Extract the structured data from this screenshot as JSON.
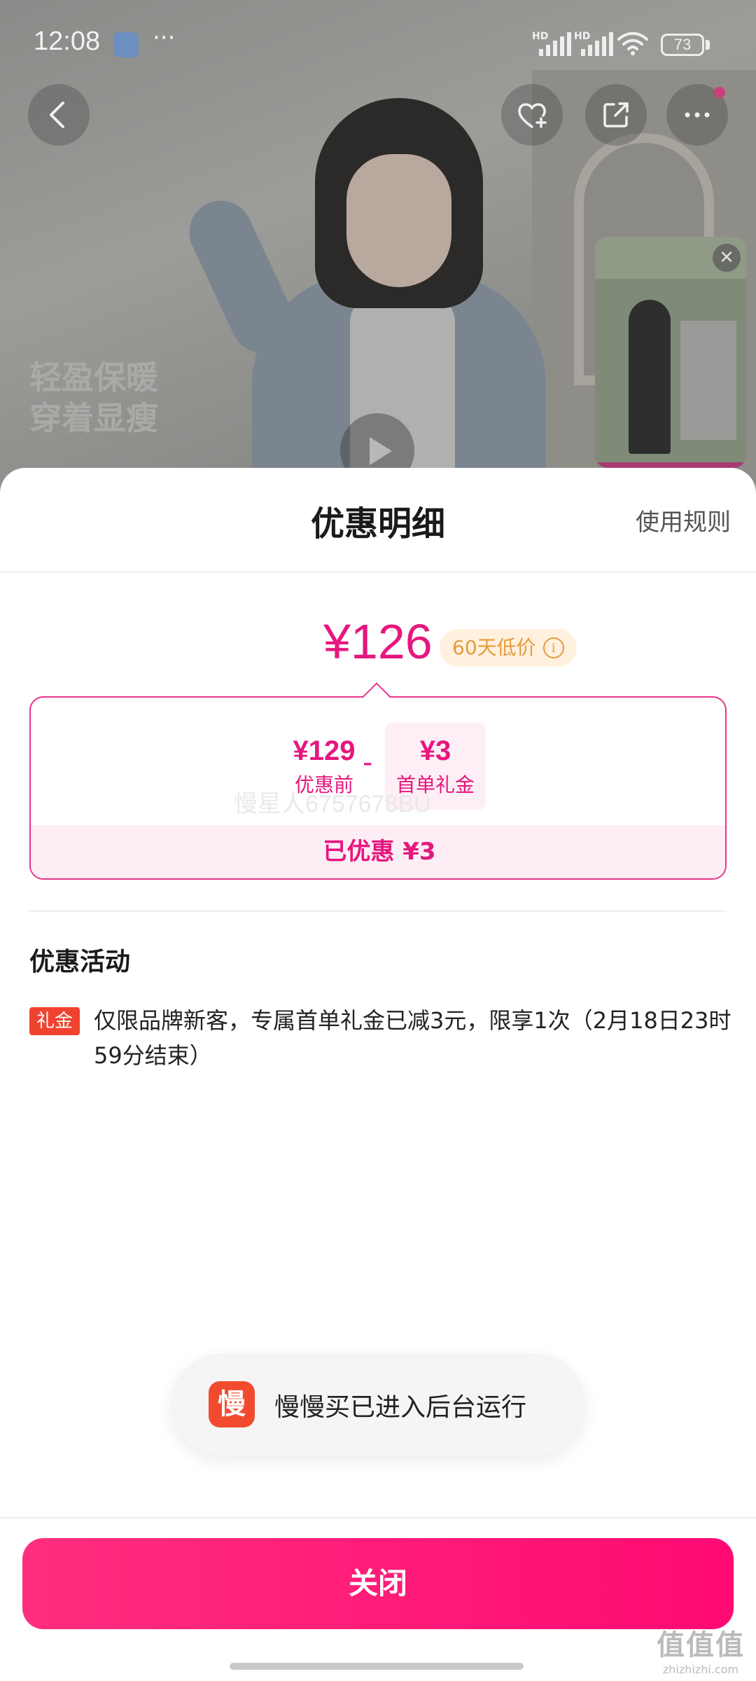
{
  "status_bar": {
    "time": "12:08",
    "more": "···",
    "battery": "73",
    "hd1": "HD",
    "hd2": "HD"
  },
  "product_bg": {
    "promo_line1": "轻盈保暖",
    "promo_line2": "穿着显瘦"
  },
  "header_icons": [
    "back-icon",
    "favorite-plus-icon",
    "share-icon",
    "more-icon"
  ],
  "sheet": {
    "title": "优惠明细",
    "rules_link": "使用规则",
    "final_price": "¥126",
    "low_price_badge": "60天低价",
    "original_price": "¥129",
    "original_label": "优惠前",
    "minus": "-",
    "coupon_amount": "¥3",
    "coupon_label": "首单礼金",
    "watermark": "慢星人6757678BU",
    "saved_text": "已优惠 ¥3",
    "activity_section_title": "优惠活动",
    "activity": {
      "tag": "礼金",
      "text": "仅限品牌新客，专属首单礼金已减3元，限享1次（2月18日23时59分结束）"
    }
  },
  "toast": {
    "icon_text": "慢",
    "message": "慢慢买已进入后台运行"
  },
  "close_button": "关闭",
  "brand_watermark": {
    "title": "值值值",
    "url": "zhizhizhi.com"
  },
  "colors": {
    "accent": "#E6177F",
    "button": "#FF0A73",
    "tag": "#F0432F",
    "badge_bg": "#FFF1DE"
  }
}
